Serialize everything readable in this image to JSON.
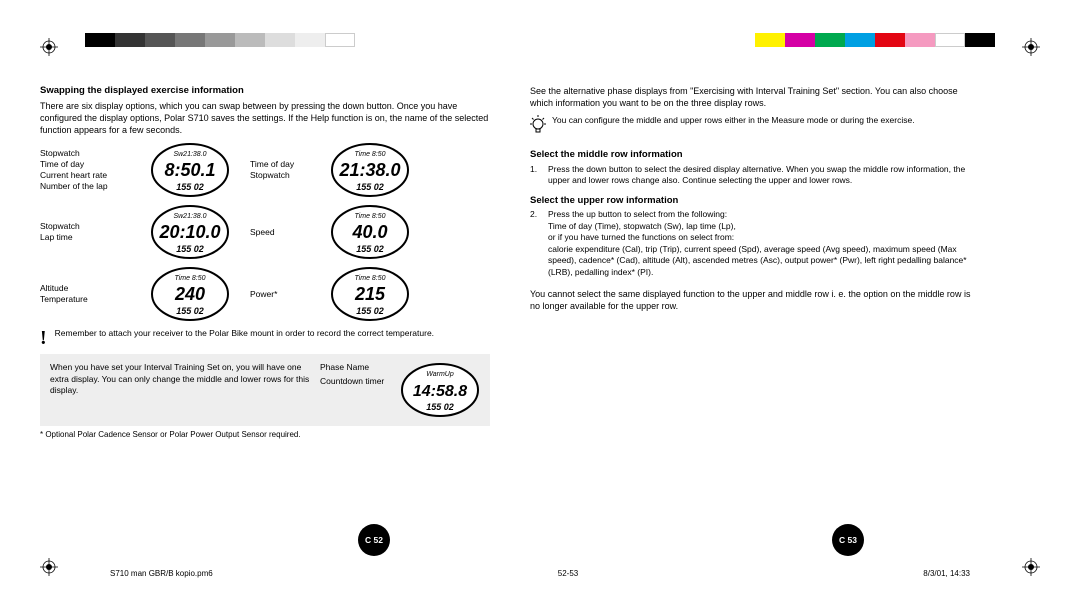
{
  "left": {
    "heading": "Swapping the displayed exercise information",
    "intro": "There are six display options, which you can swap between by pressing the down button. Once you have configured the display options, Polar S710 saves the settings. If the Help function is on, the name of the selected function appears for a few seconds.",
    "grid": {
      "row1": {
        "labelsA": [
          "Stopwatch",
          "Time of day",
          "Current heart rate",
          "Number of the lap"
        ],
        "watchA": {
          "top": "Sw21:38.0",
          "big": "8:50.1",
          "small": "155 02"
        },
        "labelsB": [
          "Time of day",
          "Stopwatch"
        ],
        "watchB": {
          "top": "Time 8:50",
          "big": "21:38.0",
          "small": "155 02"
        }
      },
      "row2": {
        "labelsA": [
          "Stopwatch",
          "Lap time"
        ],
        "watchA": {
          "top": "Sw21:38.0",
          "big": "20:10.0",
          "small": "155 02"
        },
        "labelsB": [
          "Speed"
        ],
        "watchB": {
          "top": "Time 8:50",
          "big": "40.0",
          "small": "155 02"
        }
      },
      "row3": {
        "labelsA": [
          "Altitude",
          "",
          "Temperature"
        ],
        "watchA": {
          "top": "Time 8:50",
          "big": "240",
          "small": "155 02"
        },
        "labelsB": [
          "Power*"
        ],
        "watchB": {
          "top": "Time 8:50",
          "big": "215",
          "small": "155 02"
        }
      }
    },
    "reminder": "Remember to attach your receiver to the Polar Bike mount in order to record the correct temperature.",
    "interval": {
      "text": "When you have set your Interval Training Set on, you will have one extra display. You can only change the middle and lower rows for this display.",
      "labels": [
        "Phase Name",
        "Countdown timer"
      ],
      "watch": {
        "top": "WarmUp",
        "big": "14:58.8",
        "small": "155 02"
      }
    },
    "footnote": "* Optional Polar Cadence Sensor or Polar Power Output Sensor required."
  },
  "right": {
    "intro": "See the alternative phase displays from \"Exercising with Interval Training Set\" section. You can also choose which information you want to be on the three display rows.",
    "tip": "You can configure the middle and upper rows either in the Measure mode or during the exercise.",
    "h_mid": "Select the middle row information",
    "mid_body": "Press the down button to select the desired display alternative. When you swap the middle row information, the upper and lower rows change also. Continue selecting the upper and lower rows.",
    "h_up": "Select the upper row information",
    "up_body1": "Press the up button to select from the following:",
    "up_body2": "Time of day (Time), stopwatch (Sw), lap time (Lp),",
    "up_body3": "or if you have turned the functions on select from:",
    "up_body4": "calorie expenditure (Cal), trip (Trip), current speed (Spd), average speed (Avg speed), maximum speed (Max speed), cadence* (Cad), altitude (Alt), ascended metres (Asc), output power* (Pwr), left right pedalling balance* (LRB), pedalling index* (PI).",
    "note": "You cannot select the same displayed function to the upper and middle row i. e. the option on the middle row is no longer available for the upper row."
  },
  "pagenums": {
    "left": "C 52",
    "right": "C 53"
  },
  "footer": {
    "doc": "S710 man GBR/B kopio.pm6",
    "pages": "52-53",
    "date": "8/3/01, 14:33"
  },
  "colorbars": {
    "left": [
      "#000",
      "#333",
      "#555",
      "#777",
      "#999",
      "#bbb",
      "#ddd",
      "#fff",
      "#fff",
      "#fff",
      "#fff",
      "#fff"
    ],
    "right": [
      "#fff",
      "#fff0",
      "#fff0",
      "#fff0",
      "#fff100",
      "#d500a5",
      "#00a94f",
      "#00a0e3",
      "#e30613",
      "#f59ac0",
      "#fff",
      "#000"
    ]
  }
}
